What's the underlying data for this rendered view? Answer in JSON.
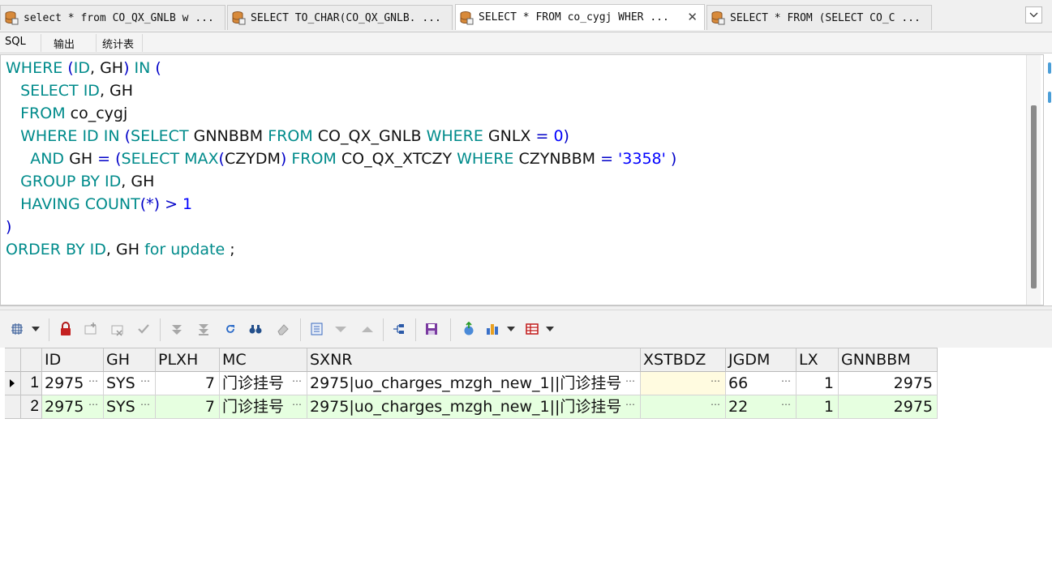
{
  "tabs": [
    {
      "label": "select * from CO_QX_GNLB w ...",
      "active": false
    },
    {
      "label": "SELECT TO_CHAR(CO_QX_GNLB. ...",
      "active": false
    },
    {
      "label": "SELECT * FROM co_cygj WHER ...",
      "active": true
    },
    {
      "label": "SELECT * FROM (SELECT CO_C ...",
      "active": false
    }
  ],
  "tab_close_symbol": "✕",
  "subtabs": [
    "SQL",
    "输出",
    "统计表"
  ],
  "editor": {
    "lines": [
      [
        [
          "kw",
          "WHERE "
        ],
        [
          "op",
          "("
        ],
        [
          "kw",
          "ID"
        ],
        [
          "t",
          ", GH"
        ],
        [
          "op",
          ")"
        ],
        [
          "kw",
          " IN "
        ],
        [
          "op",
          "("
        ]
      ],
      [
        [
          "t",
          "   "
        ],
        [
          "kw",
          "SELECT ID"
        ],
        [
          "t",
          ", GH"
        ]
      ],
      [
        [
          "t",
          "   "
        ],
        [
          "kw",
          "FROM "
        ],
        [
          "t",
          "co_cygj"
        ]
      ],
      [
        [
          "t",
          "   "
        ],
        [
          "kw",
          "WHERE ID IN "
        ],
        [
          "op",
          "("
        ],
        [
          "kw",
          "SELECT "
        ],
        [
          "t",
          "GNNBBM "
        ],
        [
          "kw",
          "FROM "
        ],
        [
          "t",
          "CO_QX_GNLB "
        ],
        [
          "kw",
          "WHERE "
        ],
        [
          "t",
          "GNLX "
        ],
        [
          "op",
          "= "
        ],
        [
          "num",
          "0"
        ],
        [
          "op",
          ")"
        ]
      ],
      [
        [
          "t",
          "     "
        ],
        [
          "kw",
          "AND "
        ],
        [
          "t",
          "GH "
        ],
        [
          "op",
          "= ("
        ],
        [
          "kw",
          "SELECT MAX"
        ],
        [
          "op",
          "("
        ],
        [
          "t",
          "CZYDM"
        ],
        [
          "op",
          ")"
        ],
        [
          "kw",
          " FROM "
        ],
        [
          "t",
          "CO_QX_XTCZY "
        ],
        [
          "kw",
          "WHERE "
        ],
        [
          "t",
          "CZYNBBM "
        ],
        [
          "op",
          "= "
        ],
        [
          "str",
          "'3358'"
        ],
        [
          "t",
          " "
        ],
        [
          "op",
          ")"
        ]
      ],
      [
        [
          "t",
          "   "
        ],
        [
          "kw",
          "GROUP BY ID"
        ],
        [
          "t",
          ", GH"
        ]
      ],
      [
        [
          "t",
          "   "
        ],
        [
          "kw",
          "HAVING COUNT"
        ],
        [
          "op",
          "(*) > "
        ],
        [
          "num",
          "1"
        ]
      ],
      [
        [
          "op",
          ")"
        ]
      ],
      [
        [
          "kw",
          "ORDER BY ID"
        ],
        [
          "t",
          ", GH "
        ],
        [
          "kw",
          "for update"
        ],
        [
          "t",
          " ;"
        ]
      ]
    ]
  },
  "colors": {
    "keyword": "#008b8b",
    "number": "#0000ff",
    "row_edited": "#e6ffe0",
    "row_highlight": "#fffbe0"
  },
  "toolbar_icons": [
    "query-options-icon",
    "lock-icon",
    "insert-record-icon",
    "delete-record-icon",
    "post-changes-icon",
    "fetch-next-page-icon",
    "fetch-last-page-icon",
    "refresh-icon",
    "find-icon",
    "clear-icon",
    "save-query-icon",
    "move-down-icon",
    "move-up-icon",
    "link-icon",
    "save-icon",
    "export-icon",
    "chart-icon",
    "grid-view-icon"
  ],
  "grid": {
    "columns": [
      "ID",
      "GH",
      "PLXH",
      "MC",
      "SXNR",
      "XSTBDZ",
      "JGDM",
      "LX",
      "GNNBBM"
    ],
    "rows": [
      {
        "num": "1",
        "ID": "2975",
        "GH": "SYS",
        "PLXH": "7",
        "MC": "门诊挂号",
        "SXNR": "2975|uo_charges_mzgh_new_1||门诊挂号",
        "XSTBDZ": "",
        "JGDM": "66",
        "LX": "1",
        "GNNBBM": "2975"
      },
      {
        "num": "2",
        "ID": "2975",
        "GH": "SYS",
        "PLXH": "7",
        "MC": "门诊挂号",
        "SXNR": "2975|uo_charges_mzgh_new_1||门诊挂号",
        "XSTBDZ": "",
        "JGDM": "22",
        "LX": "1",
        "GNNBBM": "2975"
      }
    ],
    "ellipsis": "…"
  }
}
